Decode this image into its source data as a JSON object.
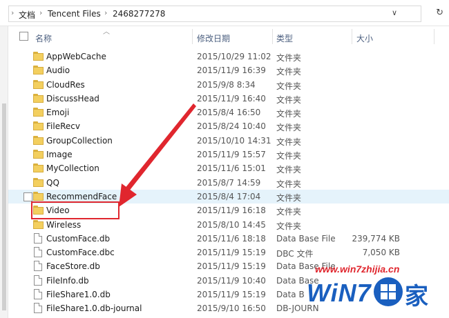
{
  "address_bar": {
    "crumbs": [
      "文档",
      "Tencent Files",
      "2468277278"
    ],
    "dropdown_icon": "chevron-down-icon",
    "refresh_icon": "refresh-icon"
  },
  "columns": {
    "name": "名称",
    "date": "修改日期",
    "type": "类型",
    "size": "大小"
  },
  "files": [
    {
      "name": "AppWebCache",
      "date": "2015/10/29 11:02",
      "type": "文件夹",
      "size": "",
      "kind": "folder"
    },
    {
      "name": "Audio",
      "date": "2015/11/9 16:39",
      "type": "文件夹",
      "size": "",
      "kind": "folder"
    },
    {
      "name": "CloudRes",
      "date": "2015/9/8 8:34",
      "type": "文件夹",
      "size": "",
      "kind": "folder"
    },
    {
      "name": "DiscussHead",
      "date": "2015/11/9 16:40",
      "type": "文件夹",
      "size": "",
      "kind": "folder"
    },
    {
      "name": "Emoji",
      "date": "2015/8/4 16:50",
      "type": "文件夹",
      "size": "",
      "kind": "folder"
    },
    {
      "name": "FileRecv",
      "date": "2015/8/24 10:40",
      "type": "文件夹",
      "size": "",
      "kind": "folder"
    },
    {
      "name": "GroupCollection",
      "date": "2015/10/10 14:31",
      "type": "文件夹",
      "size": "",
      "kind": "folder"
    },
    {
      "name": "Image",
      "date": "2015/11/9 15:57",
      "type": "文件夹",
      "size": "",
      "kind": "folder"
    },
    {
      "name": "MyCollection",
      "date": "2015/11/6 15:01",
      "type": "文件夹",
      "size": "",
      "kind": "folder"
    },
    {
      "name": "QQ",
      "date": "2015/8/7 14:59",
      "type": "文件夹",
      "size": "",
      "kind": "folder"
    },
    {
      "name": "RecommendFace",
      "date": "2015/8/4 17:04",
      "type": "文件夹",
      "size": "",
      "kind": "folder",
      "hover": true
    },
    {
      "name": "Video",
      "date": "2015/11/9 16:18",
      "type": "文件夹",
      "size": "",
      "kind": "folder",
      "highlighted": true
    },
    {
      "name": "Wireless",
      "date": "2015/8/10 14:45",
      "type": "文件夹",
      "size": "",
      "kind": "folder"
    },
    {
      "name": "CustomFace.db",
      "date": "2015/11/6 18:18",
      "type": "Data Base File",
      "size": "239,774 KB",
      "kind": "file"
    },
    {
      "name": "CustomFace.dbc",
      "date": "2015/11/9 15:19",
      "type": "DBC 文件",
      "size": "7,050 KB",
      "kind": "file"
    },
    {
      "name": "FaceStore.db",
      "date": "2015/11/9 15:19",
      "type": "Data Base File",
      "size": "",
      "kind": "file"
    },
    {
      "name": "FileInfo.db",
      "date": "2015/11/9 10:40",
      "type": "Data Base",
      "size": "",
      "kind": "file"
    },
    {
      "name": "FileShare1.0.db",
      "date": "2015/11/9 15:19",
      "type": "Data B",
      "size": "",
      "kind": "file"
    },
    {
      "name": "FileShare1.0.db-journal",
      "date": "2015/9/10 16:50",
      "type": "DB-JOURN",
      "size": "",
      "kind": "file"
    }
  ],
  "watermark": {
    "url": "www.win7zhijia.cn",
    "logo_text": "WiN7",
    "logo_han": "家"
  },
  "colors": {
    "highlight_box": "#e0262e",
    "hover_row": "#e5f3fb",
    "folder": "#f3cf5f",
    "header_text": "#4d6080",
    "watermark_blue": "#1a5fbf"
  }
}
